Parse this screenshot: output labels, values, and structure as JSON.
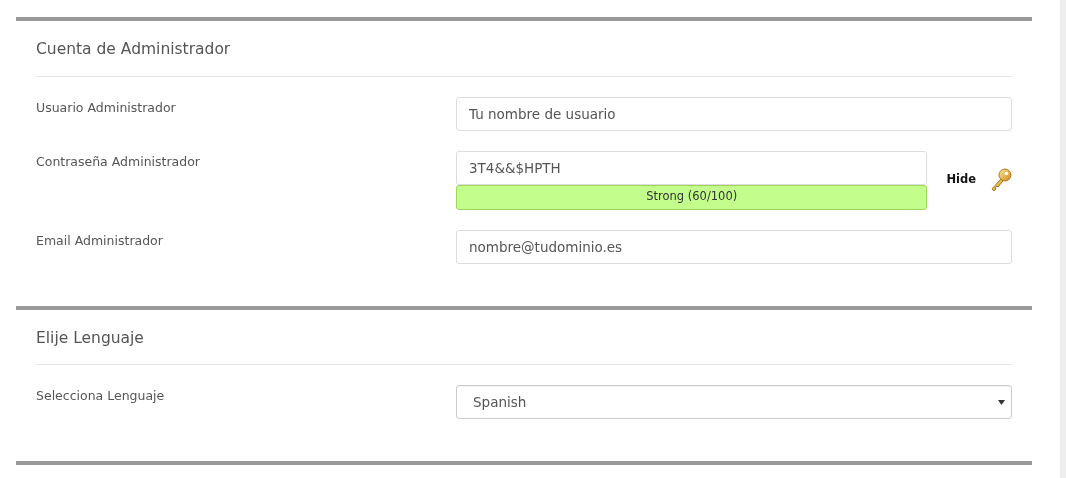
{
  "sections": [
    {
      "title": "Cuenta de Administrador",
      "rows": [
        {
          "kind": "text",
          "label": "Usuario Administrador",
          "placeholder": "Tu nombre de usuario"
        },
        {
          "kind": "password",
          "label": "Contraseña Administrador",
          "value": "3T4&&$HPTH",
          "toggle": "Hide",
          "meter": {
            "kind": "strong",
            "text": "Strong (60/100)"
          }
        },
        {
          "kind": "text",
          "label": "Email Administrador",
          "placeholder": "nombre@tudominio.es"
        }
      ]
    },
    {
      "title": "Elije Lenguaje",
      "rows": [
        {
          "kind": "select",
          "label": "Selecciona Lenguaje",
          "value": "Spanish"
        }
      ]
    }
  ]
}
